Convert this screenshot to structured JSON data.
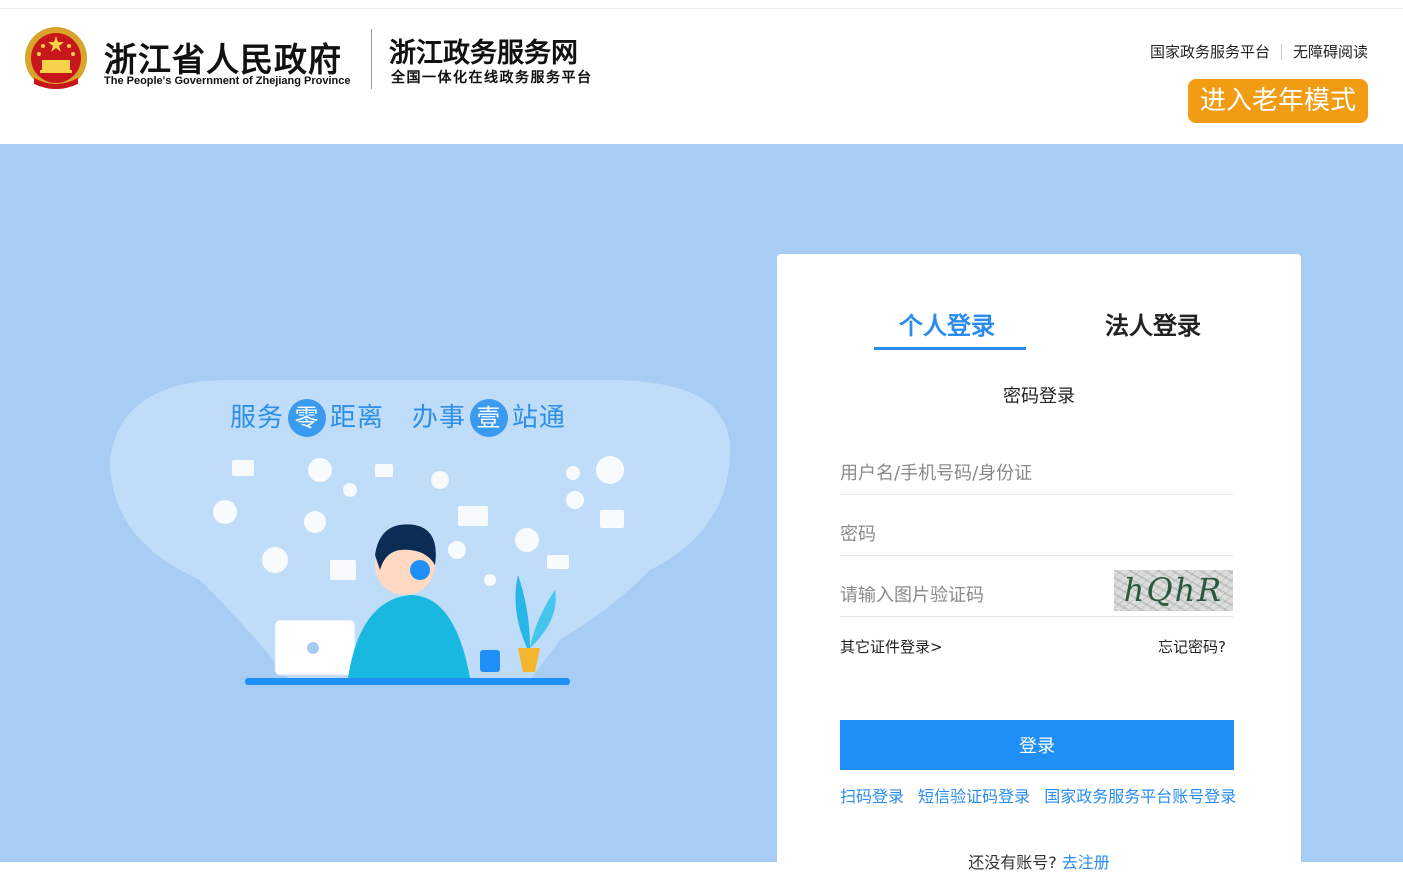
{
  "header": {
    "gov_title": "浙江省人民政府",
    "gov_subtitle": "The People's Government of Zhejiang Province",
    "site_title": "浙江政务服务网",
    "site_subtitle": "全国一体化在线政务服务平台",
    "links": [
      "国家政务服务平台",
      "无障碍阅读"
    ],
    "elder_mode": "进入老年模式"
  },
  "banner": {
    "slogan_part1": "服务",
    "slogan_circle1": "零",
    "slogan_part2": "距离",
    "slogan_part3": "办事",
    "slogan_circle2": "壹",
    "slogan_part4": "站通"
  },
  "login": {
    "tabs": [
      "个人登录",
      "法人登录"
    ],
    "active_tab": "个人登录",
    "subtitle": "密码登录",
    "username_placeholder": "用户名/手机号码/身份证",
    "password_placeholder": "密码",
    "captcha_placeholder": "请输入图片验证码",
    "captcha_text": "hQhR",
    "other_cert": "其它证件登录>",
    "forgot": "忘记密码?",
    "submit": "登录",
    "alt_links": [
      "扫码登录",
      "短信验证码登录",
      "国家政务服务平台账号登录"
    ],
    "register_prompt": "还没有账号?",
    "register_link": "去注册"
  },
  "colors": {
    "accent": "#2a8cf0",
    "button": "#1e90f7",
    "elder_button": "#f29c13",
    "background": "#a8cdf5"
  }
}
